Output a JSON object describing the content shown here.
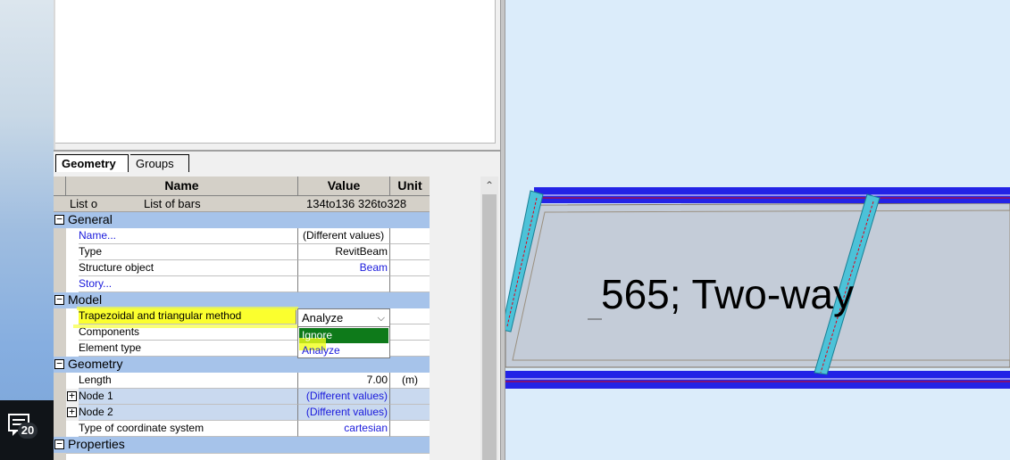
{
  "tabs": {
    "geometry": "Geometry",
    "groups": "Groups"
  },
  "grid": {
    "headers": {
      "name": "Name",
      "value": "Value",
      "unit": "Unit"
    },
    "list_row": {
      "col1": "List o",
      "col2": "List of bars",
      "value": "134to136 326to328"
    },
    "sections": {
      "general": "General",
      "model": "Model",
      "geometry": "Geometry",
      "properties": "Properties"
    },
    "rows": {
      "name": {
        "label": "Name...",
        "value": "(Different values)",
        "unit": ""
      },
      "type": {
        "label": "Type",
        "value": "RevitBeam",
        "unit": ""
      },
      "structure_object": {
        "label": "Structure object",
        "value": "Beam",
        "unit": ""
      },
      "story": {
        "label": "Story...",
        "value": "",
        "unit": ""
      },
      "trap_method": {
        "label": "Trapezoidal and triangular method",
        "value": "Analyze",
        "unit": ""
      },
      "components": {
        "label": "Components",
        "value": "",
        "unit": ""
      },
      "element_type": {
        "label": "Element type",
        "value": "",
        "unit": ""
      },
      "length": {
        "label": "Length",
        "value": "7.00",
        "unit": "(m)"
      },
      "node1": {
        "label": "Node 1",
        "value": "(Different values)",
        "unit": ""
      },
      "node2": {
        "label": "Node 2",
        "value": "(Different values)",
        "unit": ""
      },
      "coord_system": {
        "label": "Type of coordinate system",
        "value": "cartesian",
        "unit": ""
      }
    },
    "toggle_minus": "−",
    "toggle_plus": "+"
  },
  "dropdown": {
    "selected": "Analyze",
    "arrow": "⌵",
    "options": [
      "Ignore",
      "Analyze"
    ]
  },
  "viewport": {
    "label": "565; Two-way"
  },
  "taskbar": {
    "notification_count": "20"
  },
  "colors": {
    "section": "#a6c3ea",
    "highlight": "#fbff2e",
    "selected_option": "#0e7a1a",
    "link_value": "#1a1adc",
    "beam_blue": "#2323e6",
    "column_cyan": "#4cc2d8",
    "slab": "#c4ccd8"
  }
}
